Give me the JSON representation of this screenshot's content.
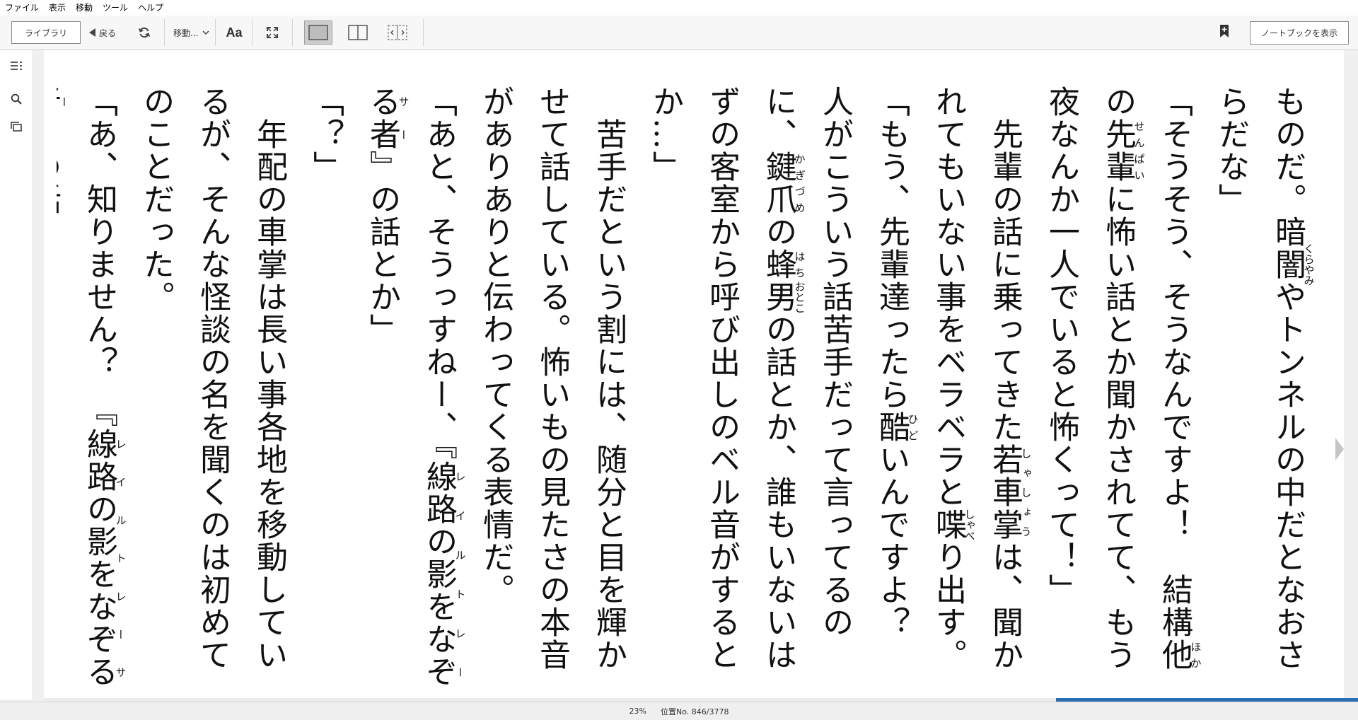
{
  "menu": [
    "ファイル",
    "表示",
    "移動",
    "ツール",
    "ヘルプ"
  ],
  "toolbar": {
    "library_label": "ライブラリ",
    "back_label": "戻る",
    "goto_label": "移動...",
    "font_label": "Aa",
    "notebook_label": "ノートブックを表示"
  },
  "page": {
    "paragraphs": [
      "ものだ。暗<ruby>闇<rt>くらやみ</rt></ruby>やトンネルの中だとなおさらだな」",
      "「そうそう、そうなんですよ！　結構<ruby>他<rt>ほか</rt></ruby>の<ruby>先輩<rt>せんぱい</rt></ruby>に怖い話とか聞かされてて、もう夜なんか一人でいると怖くって！」",
      "　先輩の話に乗ってきた<ruby>若車掌<rt>しゃしょう</rt></ruby>は、聞かれてもいない事をベラベラと<ruby>喋<rt>しゃべ</rt></ruby>り出す。",
      "「もう、先輩達ったら<ruby>酷<rt>ひど</rt></ruby>いんですよ？　人がこういう話苦手だって言ってるのに、<ruby>鍵爪<rt>かぎづめ</rt></ruby>の<ruby>蜂<rt>はち</rt></ruby><ruby>男<rt>おとこ</rt></ruby>の話とか、誰もいないはずの客室から呼び出しのベル音がするとか…」",
      "　苦手だという割には、随分と目を輝かせて話している。怖いもの見たさの本音がありありと伝わってくる表情だ。",
      "「あと、そうっすねー、『<ruby>線路の影をなぞる者<rt>レイルトレーサー</rt></ruby>』の話とか」",
      "「？」",
      "　年配の車掌は長い事各地を移動しているが、そんな怪談の名を聞くのは初めてのことだった。",
      "「あ、知りません？　『<ruby>線路の影をなぞる者<rt>レイルトレーサー</rt></ruby>』の話」",
      "　正直興味はなかったが、そろそろ『予定のポ"
    ]
  },
  "status": {
    "percent": "23%",
    "location": "位置No. 846/3778",
    "progress_fraction": 0.23
  },
  "colors": {
    "progress": "#2a6fb5",
    "page_bg": "#ffffff",
    "chrome_bg": "#f0f0f0"
  },
  "icons": [
    "toc-icon",
    "search-icon",
    "flashcards-icon",
    "sync-icon",
    "chevron-down-icon",
    "fullscreen-icon",
    "single-column-icon",
    "two-column-icon",
    "auto-column-icon",
    "bookmark-add-icon",
    "next-page-icon"
  ]
}
